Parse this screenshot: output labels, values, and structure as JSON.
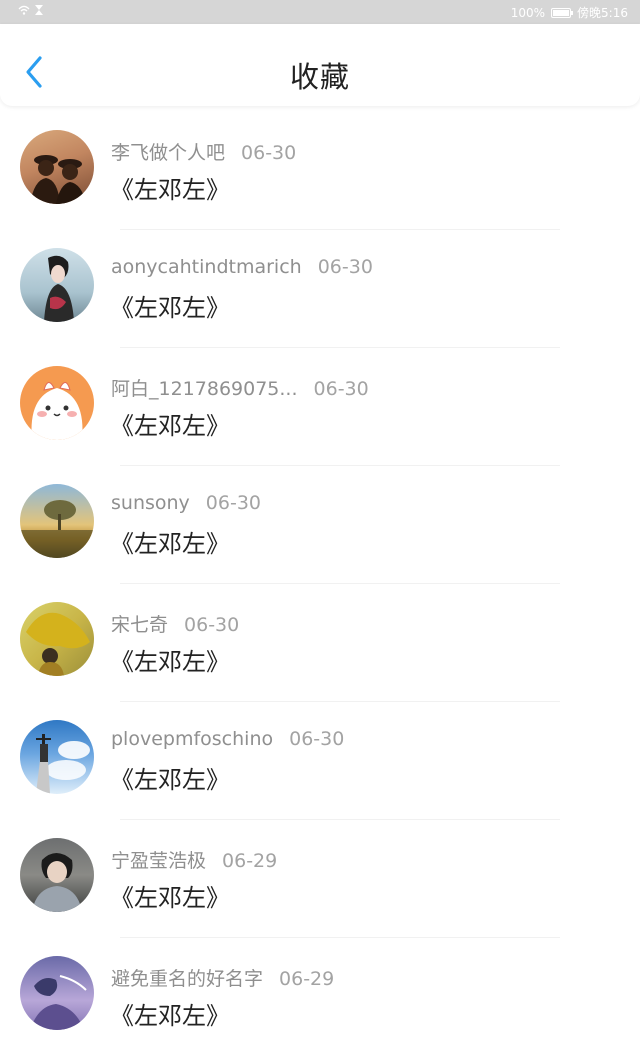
{
  "status_bar": {
    "battery_text": "100%",
    "time": "傍晚5:16"
  },
  "header": {
    "title": "收藏",
    "back_icon": "chevron-left-icon",
    "accent_color": "#2b9ef0"
  },
  "favorites": [
    {
      "user": "李飞做个人吧",
      "date": "06-30",
      "work": "《左邓左》"
    },
    {
      "user": "aonycahtindtmarich",
      "date": "06-30",
      "work": "《左邓左》"
    },
    {
      "user": "阿白_1217869075...",
      "date": "06-30",
      "work": "《左邓左》"
    },
    {
      "user": "sunsony",
      "date": "06-30",
      "work": "《左邓左》"
    },
    {
      "user": "宋七奇",
      "date": "06-30",
      "work": "《左邓左》"
    },
    {
      "user": "plovepmfoschino",
      "date": "06-30",
      "work": "《左邓左》"
    },
    {
      "user": "宁盈莹浩极",
      "date": "06-29",
      "work": "《左邓左》"
    },
    {
      "user": "避免重名的好名字",
      "date": "06-29",
      "work": "《左邓左》"
    }
  ]
}
